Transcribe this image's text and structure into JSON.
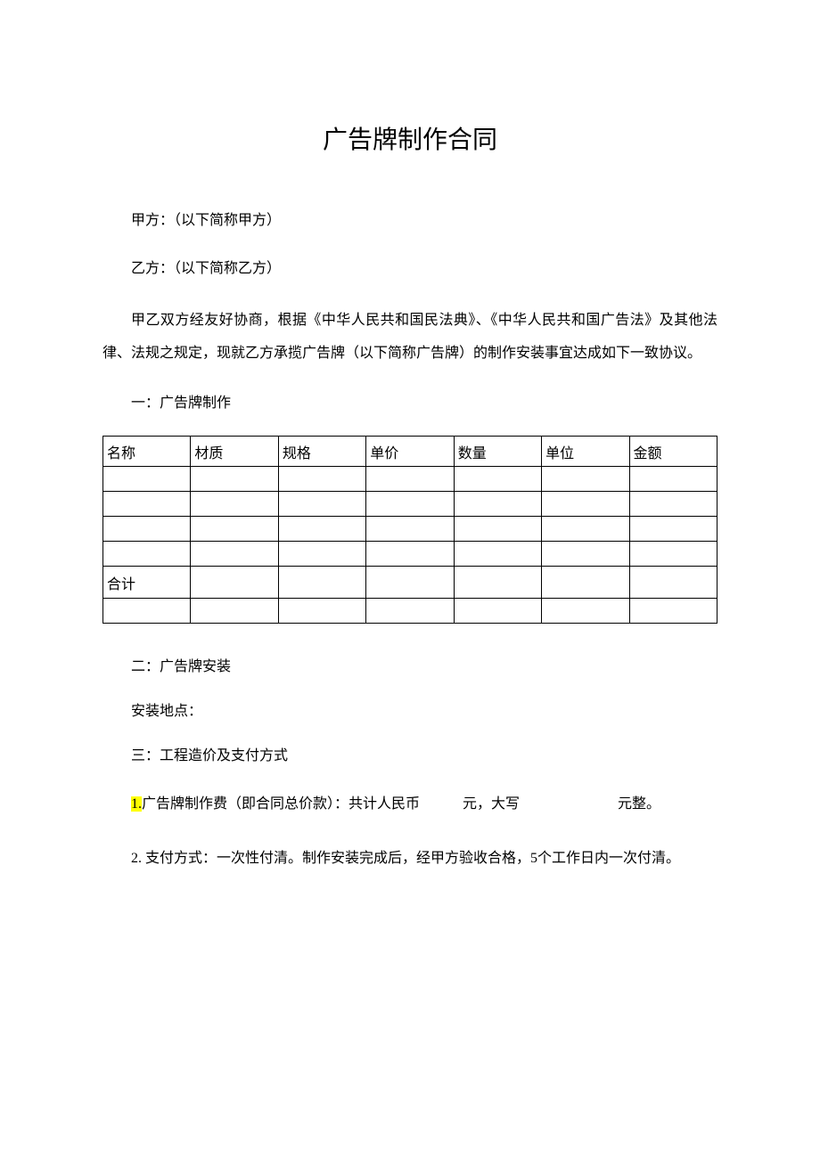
{
  "title": "广告牌制作合同",
  "party_a": "甲方：（以下简称甲方）",
  "party_b": "乙方：（以下简称乙方）",
  "intro": "甲乙双方经友好协商，根据《中华人民共和国民法典》、《中华人民共和国广告法》及其他法律、法规之规定，现就乙方承揽广告牌（以下简称广告牌）的制作安装事宜达成如下一致协议。",
  "section1_heading": "一：广告牌制作",
  "table": {
    "headers": [
      "名称",
      "材质",
      "规格",
      "单价",
      "数量",
      "单位",
      "金额"
    ],
    "total_label": "合计"
  },
  "section2_heading": "二：广告牌安装",
  "install_location_label": "安装地点：",
  "section3_heading": "三：工程造价及支付方式",
  "item1_num": "1.",
  "item1_before": "广告牌制作费（即合同总价款）：共计人民币",
  "item1_yuan": "元，大写",
  "item1_tail": "元整。",
  "item2": "2. 支付方式：一次性付清。制作安装完成后，经甲方验收合格，5个工作日内一次付清。"
}
